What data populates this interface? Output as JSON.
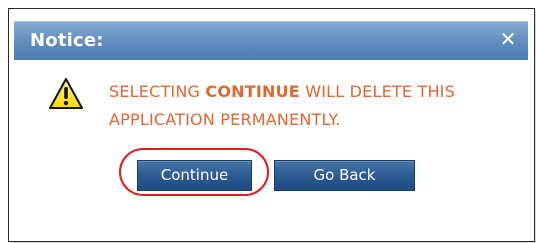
{
  "dialog": {
    "title": "Notice:",
    "close_icon": "close-icon",
    "warning_icon": "warning-icon",
    "message_before": "SELECTING ",
    "message_emphasis": "CONTINUE",
    "message_after": " WILL DELETE THIS APPLICATION PERMANENTLY.",
    "buttons": {
      "continue": "Continue",
      "go_back": "Go Back"
    }
  },
  "colors": {
    "titlebar": "#5f8cbf",
    "message": "#e06730",
    "button": "#2e5c92",
    "highlight": "#e11c1c"
  }
}
